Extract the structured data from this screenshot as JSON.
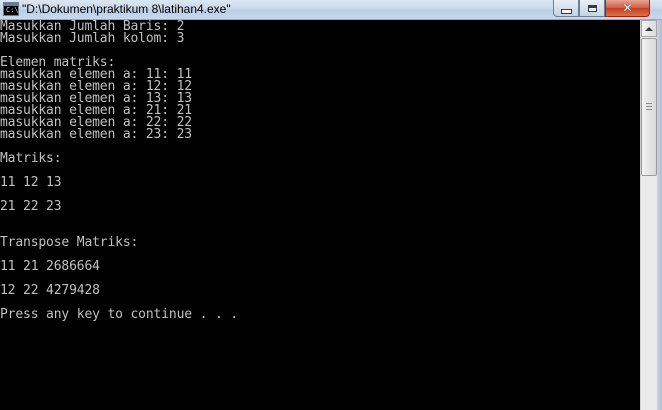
{
  "window": {
    "title": "\"D:\\Dokumen\\praktikum 8\\latihan4.exe\"",
    "icon": "console-app-icon",
    "buttons": {
      "minimize": "minimize-icon",
      "maximize": "maximize-icon",
      "close": "close-icon",
      "close_glyph": "✕"
    }
  },
  "console": {
    "lines": [
      "Masukkan Jumlah Baris: 2",
      "Masukkan Jumlah kolom: 3",
      "",
      "Elemen matriks:",
      "masukkan elemen a: 11: 11",
      "masukkan elemen a: 12: 12",
      "masukkan elemen a: 13: 13",
      "masukkan elemen a: 21: 21",
      "masukkan elemen a: 22: 22",
      "masukkan elemen a: 23: 23",
      "",
      "Matriks:",
      "",
      "11 12 13",
      "",
      "21 22 23",
      "",
      "",
      "Transpose Matriks:",
      "",
      "11 21 2686664",
      "",
      "12 22 4279428",
      "",
      "Press any key to continue . . ."
    ],
    "text_color": "#c0c0c0",
    "background": "#000000"
  },
  "scrollbar": {
    "up_icon": "scroll-up-arrow-icon"
  }
}
